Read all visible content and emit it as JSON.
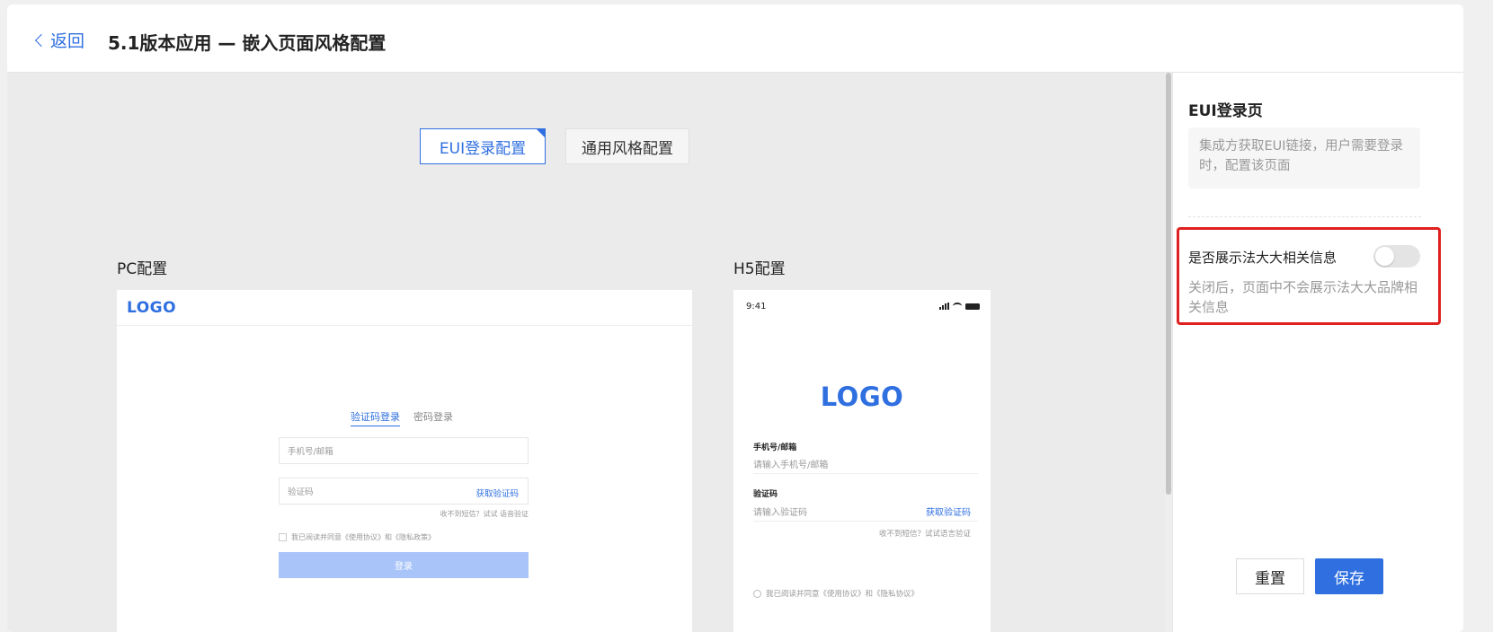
{
  "header": {
    "back_label": "返回",
    "title": "5.1版本应用 — 嵌入页面风格配置"
  },
  "tabs": [
    {
      "label": "EUI登录配置",
      "active": true
    },
    {
      "label": "通用风格配置",
      "active": false
    }
  ],
  "pc": {
    "section_label": "PC配置",
    "logo": "LOGO",
    "tab_sms": "验证码登录",
    "tab_password": "密码登录",
    "phone_placeholder": "手机号/邮箱",
    "code_placeholder": "验证码",
    "get_code": "获取验证码",
    "hint": "收不到短信？试试 语音验证",
    "agreement": "我已阅读并同意《使用协议》和《隐私政策》",
    "login_button": "登录"
  },
  "h5": {
    "section_label": "H5配置",
    "time": "9:41",
    "logo": "LOGO",
    "phone_label": "手机号/邮箱",
    "phone_placeholder": "请输入手机号/邮箱",
    "code_label": "验证码",
    "code_placeholder": "请输入验证码",
    "get_code": "获取验证码",
    "hint": "收不到短信？试试语言验证",
    "agreement": "我已阅读并同意《使用协议》和《隐私协议》"
  },
  "side": {
    "title": "EUI登录页",
    "description": "集成方获取EUI链接，用户需要登录时，配置该页面",
    "option_label": "是否展示法大大相关信息",
    "option_enabled": false,
    "option_desc": "关闭后，页面中不会展示法大大品牌相关信息",
    "reset_button": "重置",
    "save_button": "保存"
  },
  "colors": {
    "accent": "#2f6fe0",
    "highlight_border": "#e02020"
  }
}
